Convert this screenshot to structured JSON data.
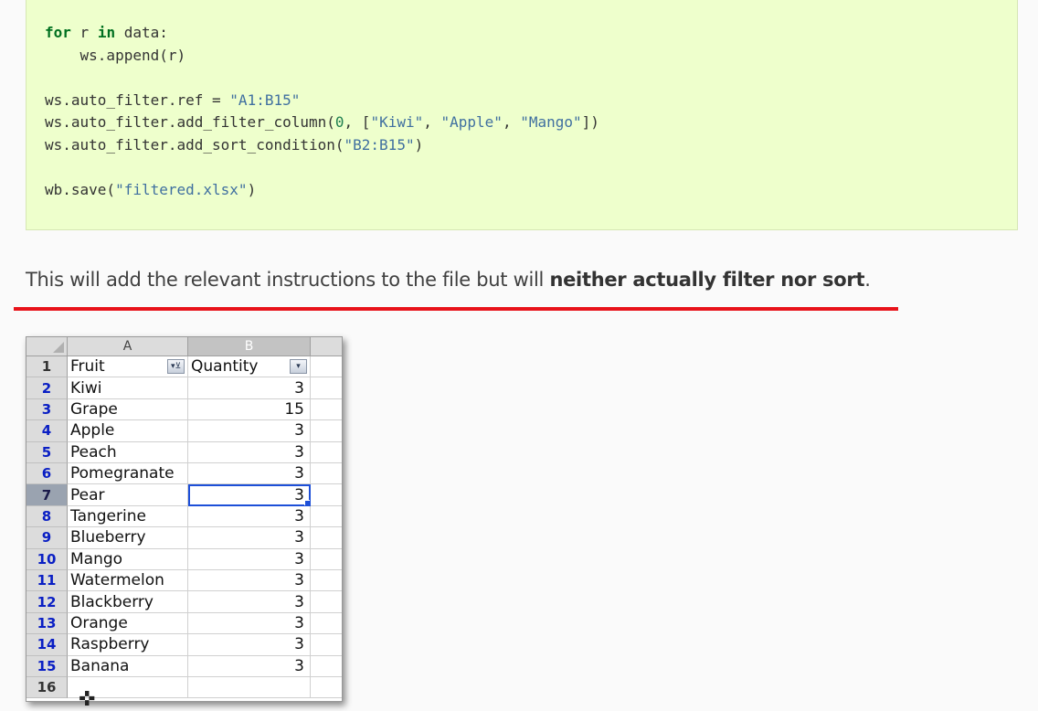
{
  "code": {
    "l1_kw1": "for",
    "l1_var": " r ",
    "l1_kw2": "in",
    "l1_rest": " data:",
    "l2": "    ws.append(r)",
    "l4_a": "ws.auto_filter.ref = ",
    "l4_s": "\"A1:B15\"",
    "l5_a": "ws.auto_filter.add_filter_column(",
    "l5_n": "0",
    "l5_b": ", [",
    "l5_s1": "\"Kiwi\"",
    "l5_c1": ", ",
    "l5_s2": "\"Apple\"",
    "l5_c2": ", ",
    "l5_s3": "\"Mango\"",
    "l5_e": "])",
    "l6_a": "ws.auto_filter.add_sort_condition(",
    "l6_s": "\"B2:B15\"",
    "l6_e": ")",
    "l8_a": "wb.save(",
    "l8_s": "\"filtered.xlsx\"",
    "l8_e": ")"
  },
  "paragraph": {
    "plain": "This will add the relevant instructions to the file but will ",
    "bold": "neither actually filter nor sort",
    "end": "."
  },
  "sheet": {
    "col_a": "A",
    "col_b": "B",
    "header_fruit": "Fruit",
    "header_quantity": "Quantity",
    "filter_a_glyph": "▾⊻",
    "filter_b_glyph": "▾",
    "selected_row": 7,
    "rows": [
      {
        "n": "2",
        "fruit": "Kiwi",
        "qty": "3"
      },
      {
        "n": "3",
        "fruit": "Grape",
        "qty": "15"
      },
      {
        "n": "4",
        "fruit": "Apple",
        "qty": "3"
      },
      {
        "n": "5",
        "fruit": "Peach",
        "qty": "3"
      },
      {
        "n": "6",
        "fruit": "Pomegranate",
        "qty": "3"
      },
      {
        "n": "7",
        "fruit": "Pear",
        "qty": "3"
      },
      {
        "n": "8",
        "fruit": "Tangerine",
        "qty": "3"
      },
      {
        "n": "9",
        "fruit": "Blueberry",
        "qty": "3"
      },
      {
        "n": "10",
        "fruit": "Mango",
        "qty": "3"
      },
      {
        "n": "11",
        "fruit": "Watermelon",
        "qty": "3"
      },
      {
        "n": "12",
        "fruit": "Blackberry",
        "qty": "3"
      },
      {
        "n": "13",
        "fruit": "Orange",
        "qty": "3"
      },
      {
        "n": "14",
        "fruit": "Raspberry",
        "qty": "3"
      },
      {
        "n": "15",
        "fruit": "Banana",
        "qty": "3"
      }
    ],
    "row1_num": "1",
    "row16_num": "16"
  },
  "colors": {
    "code_bg": "#eeffcc",
    "highlight_line": "#e8131a",
    "row_number": "#0a1fc4",
    "selection": "#1d4fd8"
  },
  "cursor_icon": "crosshair-plus-icon"
}
